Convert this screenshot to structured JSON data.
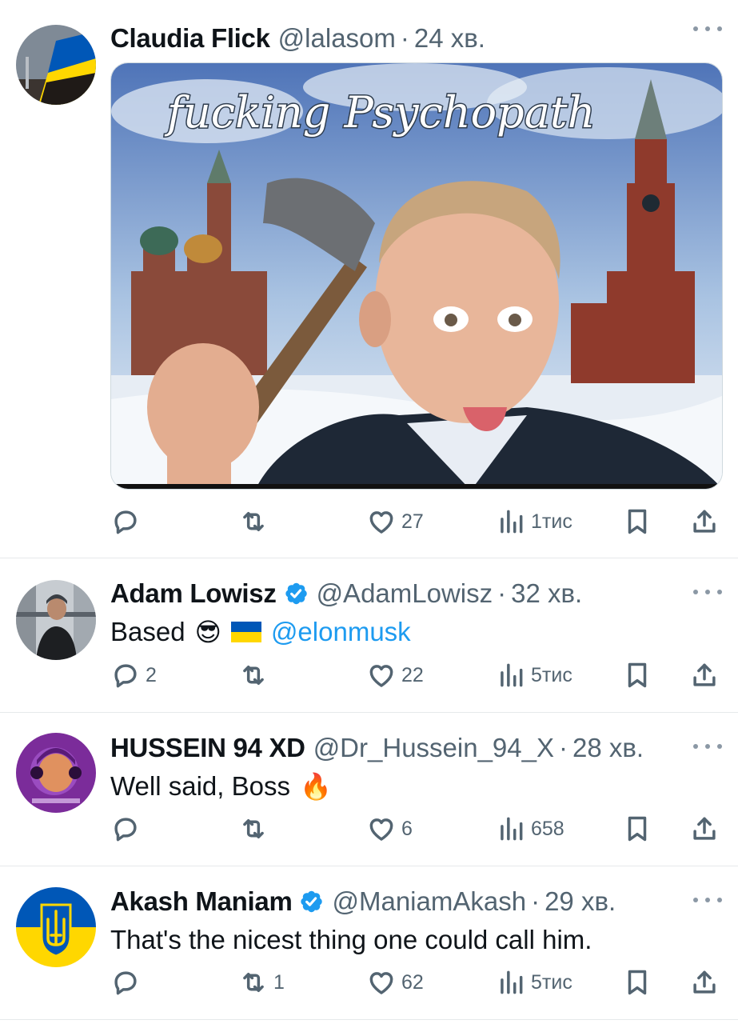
{
  "tweets": [
    {
      "name": "Claudia Flick",
      "handle": "@lalasom",
      "sep": "·",
      "time": "24 хв.",
      "verified": false,
      "text": "",
      "media_caption": "fucking Psychopath",
      "stats": {
        "replies": "",
        "retweets": "",
        "likes": "27",
        "views": "1тис"
      }
    },
    {
      "name": "Adam Lowisz",
      "handle": "@AdamLowisz",
      "sep": "·",
      "time": "32 хв.",
      "verified": true,
      "text": "Based",
      "emoji_1": "😎",
      "mention": "@elonmusk",
      "stats": {
        "replies": "2",
        "retweets": "",
        "likes": "22",
        "views": "5тис"
      }
    },
    {
      "name": "HUSSEIN 94 XD",
      "handle": "@Dr_Hussein_94_X",
      "sep": "·",
      "time": "28 хв.",
      "verified": false,
      "text": "Well said, Boss",
      "emoji_1": "🔥",
      "stats": {
        "replies": "",
        "retweets": "",
        "likes": "6",
        "views": "658"
      }
    },
    {
      "name": "Akash Maniam",
      "handle": "@ManiamAkash",
      "sep": "·",
      "time": "29 хв.",
      "verified": true,
      "text": "That's the nicest thing one could call him.",
      "stats": {
        "replies": "",
        "retweets": "1",
        "likes": "62",
        "views": "5тис"
      }
    }
  ],
  "colors": {
    "text": "#0f1419",
    "secondary": "#536471",
    "link": "#1d9bf0",
    "verified": "#1d9bf0",
    "ukraine_blue": "#0057b7",
    "ukraine_yellow": "#ffd700"
  },
  "icons": {
    "reply": "reply-icon",
    "retweet": "retweet-icon",
    "like": "heart-icon",
    "views": "views-icon",
    "bookmark": "bookmark-icon",
    "share": "share-icon",
    "more": "more-icon",
    "verified": "verified-badge-icon"
  }
}
